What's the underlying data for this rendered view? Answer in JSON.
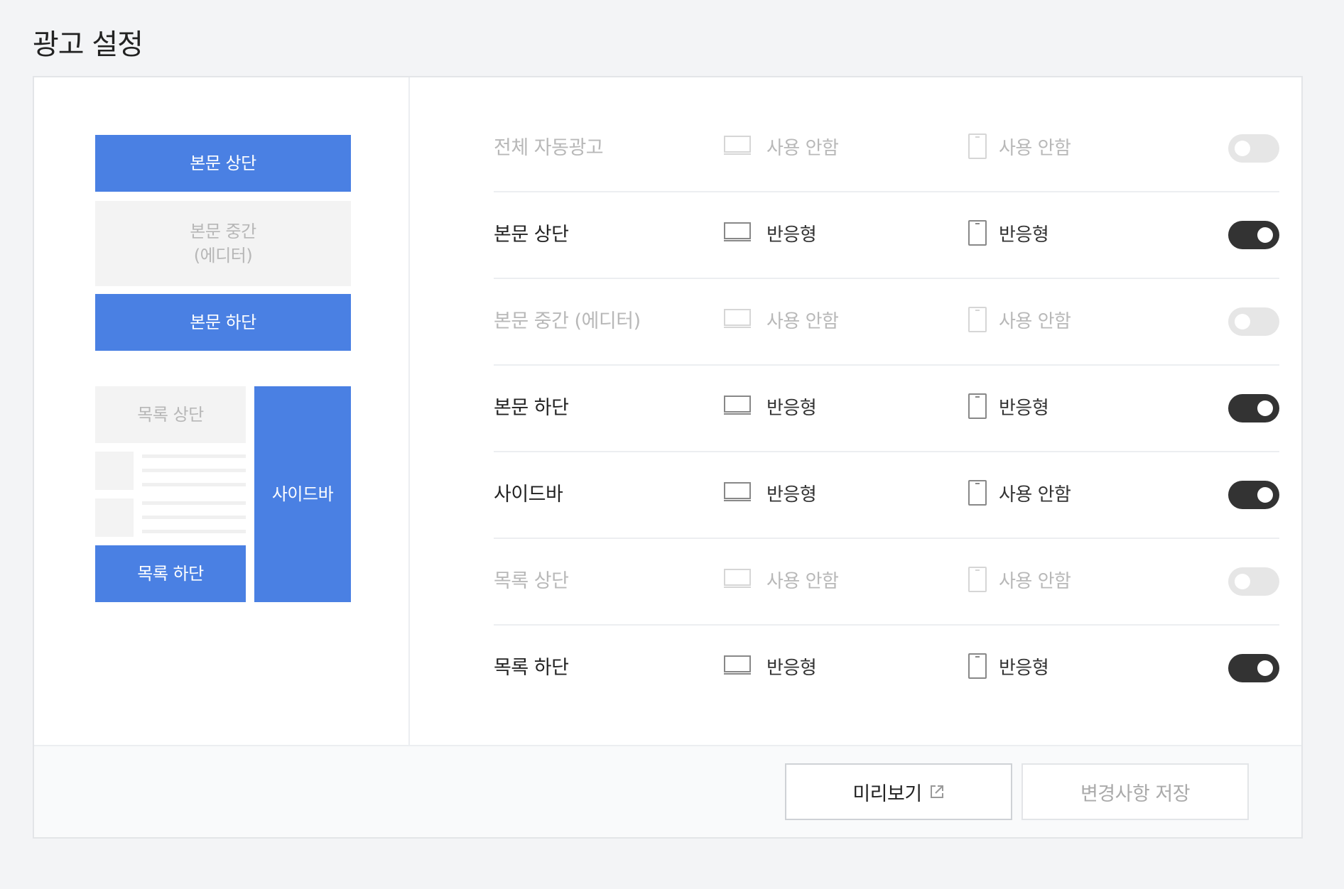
{
  "page": {
    "title": "광고 설정"
  },
  "preview": {
    "body_top": "본문 상단",
    "body_middle_line1": "본문 중간",
    "body_middle_line2": "(에디터)",
    "body_bottom": "본문 하단",
    "list_top": "목록 상단",
    "sidebar": "사이드바",
    "list_bottom": "목록 하단"
  },
  "rows": [
    {
      "label": "전체 자동광고",
      "pc": "사용 안함",
      "mobile": "사용 안함",
      "enabled": false
    },
    {
      "label": "본문 상단",
      "pc": "반응형",
      "mobile": "반응형",
      "enabled": true
    },
    {
      "label": "본문 중간 (에디터)",
      "pc": "사용 안함",
      "mobile": "사용 안함",
      "enabled": false
    },
    {
      "label": "본문 하단",
      "pc": "반응형",
      "mobile": "반응형",
      "enabled": true
    },
    {
      "label": "사이드바",
      "pc": "반응형",
      "mobile": "사용 안함",
      "enabled": true
    },
    {
      "label": "목록 상단",
      "pc": "사용 안함",
      "mobile": "사용 안함",
      "enabled": false
    },
    {
      "label": "목록 하단",
      "pc": "반응형",
      "mobile": "반응형",
      "enabled": true
    }
  ],
  "footer": {
    "preview_label": "미리보기",
    "save_label": "변경사항 저장"
  },
  "colors": {
    "accent": "#4a80e3",
    "toggle_on": "#333333",
    "toggle_off": "#e6e6e6"
  }
}
